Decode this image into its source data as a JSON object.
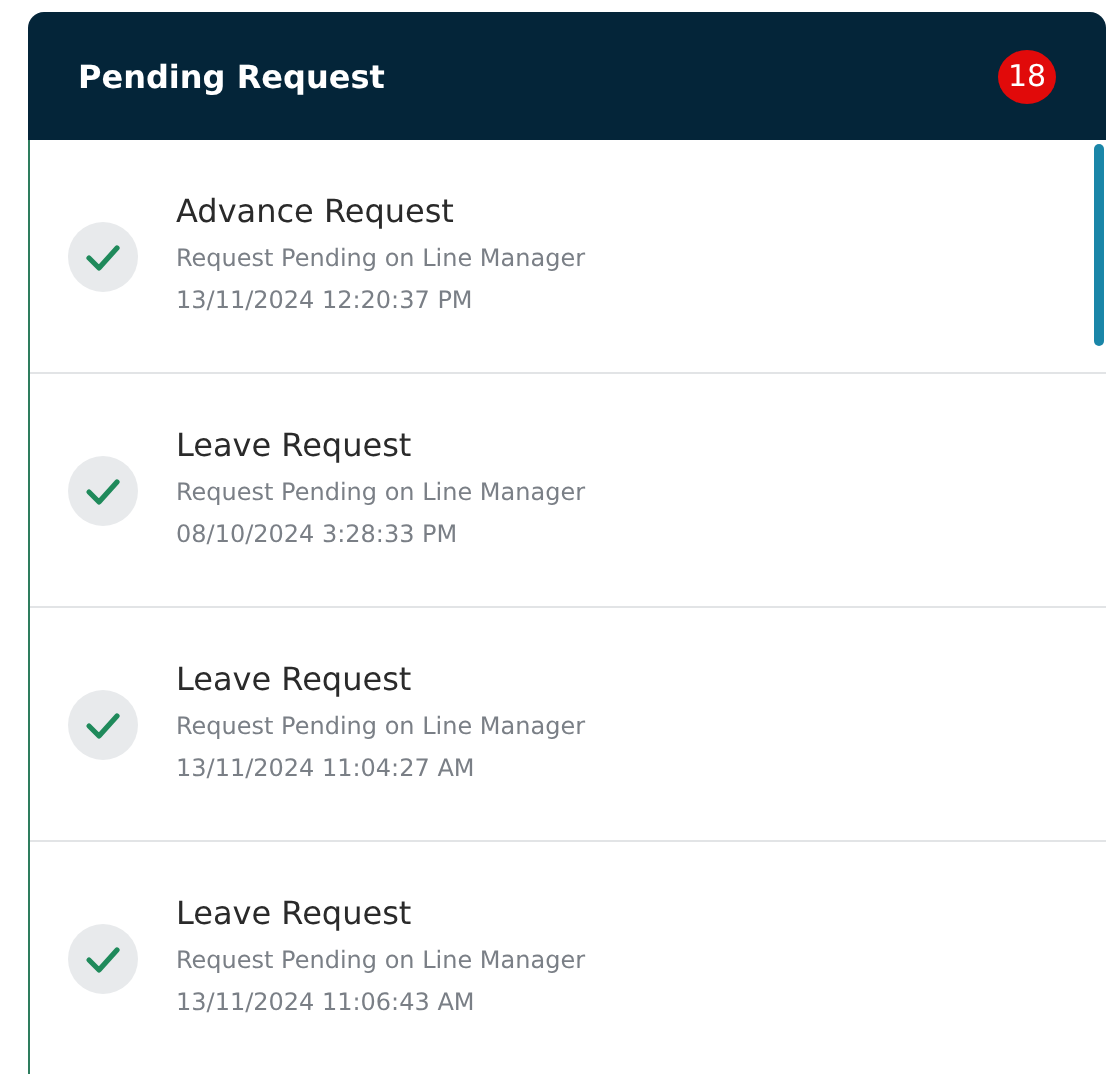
{
  "panel": {
    "title": "Pending Request",
    "badge": "18"
  },
  "requests": [
    {
      "title": "Advance Request",
      "status": "Request Pending on Line Manager",
      "time": "13/11/2024 12:20:37 PM"
    },
    {
      "title": "Leave Request",
      "status": "Request Pending on Line Manager",
      "time": "08/10/2024 3:28:33 PM"
    },
    {
      "title": "Leave Request",
      "status": "Request Pending on Line Manager",
      "time": "13/11/2024 11:04:27 AM"
    },
    {
      "title": "Leave Request",
      "status": "Request Pending on Line Manager",
      "time": "13/11/2024 11:06:43 AM"
    }
  ]
}
